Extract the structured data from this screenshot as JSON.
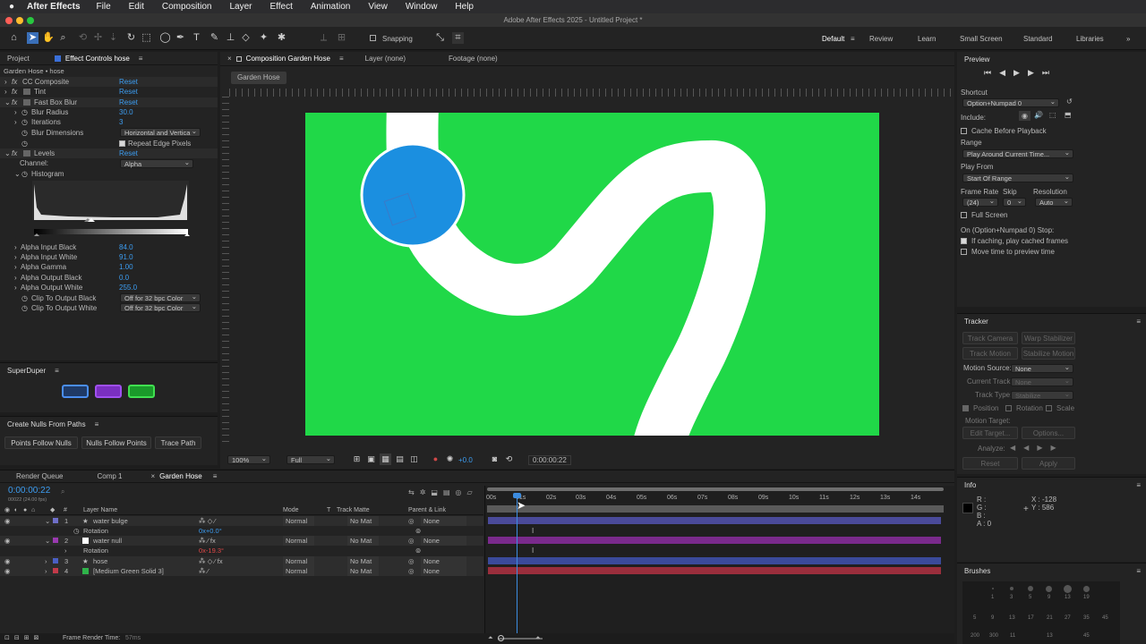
{
  "menubar": {
    "apple": "",
    "app_name": "After Effects",
    "items": [
      "File",
      "Edit",
      "Composition",
      "Layer",
      "Effect",
      "Animation",
      "View",
      "Window",
      "Help"
    ]
  },
  "window": {
    "title": "Adobe After Effects 2025 - Untitled Project *"
  },
  "toolbar": {
    "snapping_label": "Snapping",
    "workspaces": [
      "Default",
      "Review",
      "Learn",
      "Small Screen",
      "Standard",
      "Libraries"
    ]
  },
  "project_panel": {
    "tab_project": "Project",
    "tab_effect_controls": "Effect Controls hose",
    "layer_path": "Garden Hose • hose",
    "effects": [
      {
        "prefix": "fx",
        "name": "CC Composite",
        "value": "Reset"
      },
      {
        "prefix": "fx",
        "name": "Tint",
        "value": "Reset"
      },
      {
        "prefix": "fx",
        "name": "Fast Box Blur",
        "value": "Reset"
      },
      {
        "prefix": "",
        "name": "Blur Radius",
        "value": "30.0"
      },
      {
        "prefix": "",
        "name": "Iterations",
        "value": "3"
      },
      {
        "prefix": "",
        "name": "Blur Dimensions",
        "value": "Horizontal and Vertica"
      },
      {
        "prefix": "",
        "name": "",
        "value": "Repeat Edge Pixels"
      },
      {
        "prefix": "fx",
        "name": "Levels",
        "value": "Reset"
      },
      {
        "prefix": "",
        "name": "Channel:",
        "value": "Alpha"
      },
      {
        "prefix": "",
        "name": "Histogram",
        "value": ""
      }
    ],
    "levels_params": [
      {
        "name": "Alpha Input Black",
        "value": "84.0"
      },
      {
        "name": "Alpha Input White",
        "value": "91.0"
      },
      {
        "name": "Alpha Gamma",
        "value": "1.00"
      },
      {
        "name": "Alpha Output Black",
        "value": "0.0"
      },
      {
        "name": "Alpha Output White",
        "value": "255.0"
      },
      {
        "name": "Clip To Output Black",
        "value": "Off for 32 bpc Color"
      },
      {
        "name": "Clip To Output White",
        "value": "Off for 32 bpc Color"
      }
    ]
  },
  "superduper": {
    "title": "SuperDuper"
  },
  "create_nulls": {
    "title": "Create Nulls From Paths",
    "buttons": [
      "Points Follow Nulls",
      "Nulls Follow Points",
      "Trace Path"
    ]
  },
  "viewer": {
    "tab_composition": "Composition Garden Hose",
    "tab_layer": "Layer (none)",
    "tab_footage": "Footage (none)",
    "breadcrumb": "Garden Hose",
    "zoom": "100%",
    "resolution": "Full",
    "exposure": "+0.0",
    "timecode": "0:00:00:22",
    "colors": {
      "background": "#20d848",
      "hose": "#ffffff",
      "ball": "#1b8fe0"
    }
  },
  "preview": {
    "title": "Preview",
    "shortcut_label": "Shortcut",
    "shortcut_value": "Option+Numpad 0",
    "include_label": "Include:",
    "cache_before_playback": "Cache Before Playback",
    "range_label": "Range",
    "range_value": "Play Around Current Time...",
    "play_from_label": "Play From",
    "play_from_value": "Start Of Range",
    "frame_rate_label": "Frame Rate",
    "skip_label": "Skip",
    "resolution_label": "Resolution",
    "frame_rate_value": "(24)",
    "skip_value": "0",
    "resolution_value": "Auto",
    "full_screen": "Full Screen",
    "stop_label": "On (Option+Numpad 0) Stop:",
    "if_caching": "If caching, play cached frames",
    "move_time": "Move time to preview time"
  },
  "tracker": {
    "title": "Tracker",
    "track_camera": "Track Camera",
    "warp_stabilizer": "Warp Stabilizer",
    "track_motion": "Track Motion",
    "stabilize_motion": "Stabilize Motion",
    "motion_source_label": "Motion Source:",
    "motion_source_value": "None",
    "current_track_label": "Current Track:",
    "current_track_value": "None",
    "track_type_label": "Track Type:",
    "track_type_value": "Stabilize",
    "position": "Position",
    "rotation": "Rotation",
    "scale": "Scale",
    "motion_target_label": "Motion Target:",
    "edit_target": "Edit Target...",
    "options": "Options...",
    "analyze_label": "Analyze:",
    "reset": "Reset",
    "apply": "Apply"
  },
  "info": {
    "title": "Info",
    "r": "R :",
    "g": "G :",
    "b": "B :",
    "a": "A :  0",
    "x": "X : -128",
    "y": "Y :  586"
  },
  "brushes": {
    "title": "Brushes",
    "sizes_row1": [
      "1",
      "3",
      "5",
      "9",
      "13",
      "19"
    ],
    "sizes_row2": [
      "5",
      "9",
      "13",
      "17",
      "21",
      "27",
      "35",
      "45",
      "65",
      "100"
    ],
    "sizes_row3": [
      "200",
      "300",
      "11",
      "11",
      "13",
      "15",
      "45",
      "45",
      "45",
      "45"
    ]
  },
  "timeline": {
    "tabs": [
      "Render Queue",
      "Comp 1",
      "Garden Hose"
    ],
    "timecode": "0:00:00:22",
    "fps": "00022 (24.00 fps)",
    "col_layer_name": "Layer Name",
    "col_mode": "Mode",
    "col_t": "T",
    "col_track_matte": "Track Matte",
    "col_parent": "Parent & Link",
    "layers": [
      {
        "num": "1",
        "name": "water bulge",
        "mode": "Normal",
        "matte": "No Mat",
        "parent": "None",
        "color": "#6f6fc8"
      },
      {
        "num": "2",
        "name": "water null",
        "mode": "Normal",
        "matte": "No Mat",
        "parent": "None",
        "color": "#9a3ab0"
      },
      {
        "num": "3",
        "name": "hose",
        "mode": "Normal",
        "matte": "No Mat",
        "parent": "None",
        "color": "#4a5fc4"
      },
      {
        "num": "4",
        "name": "[Medium Green Solid 3]",
        "mode": "Normal",
        "matte": "No Mat",
        "parent": "None",
        "color": "#c23a4a"
      }
    ],
    "rotation_label": "Rotation",
    "rotation1_value": "0x+0.0°",
    "rotation2_value": "0x-19.3°",
    "ruler": [
      "00s",
      "01s",
      "02s",
      "03s",
      "04s",
      "05s",
      "06s",
      "07s",
      "08s",
      "09s",
      "10s",
      "11s",
      "12s",
      "13s",
      "14s"
    ],
    "frame_render_label": "Frame Render Time:",
    "frame_render_value": "57ms"
  }
}
